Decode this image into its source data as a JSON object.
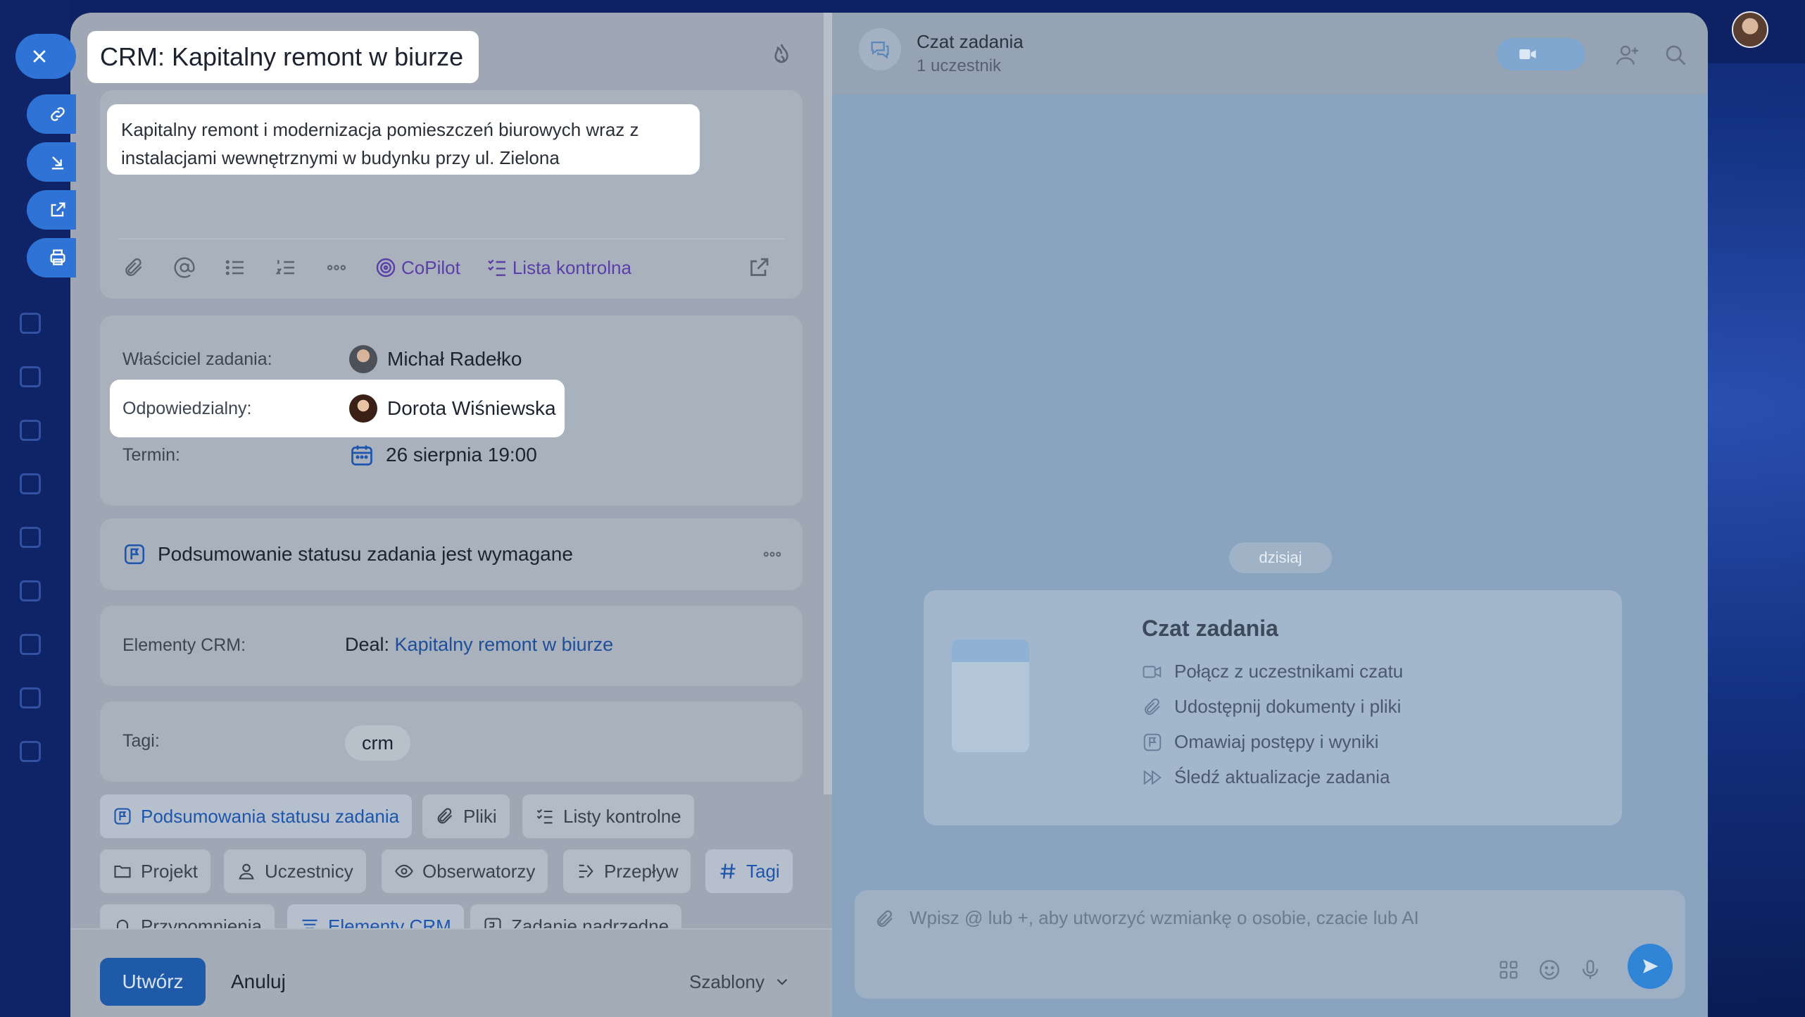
{
  "task": {
    "title": "CRM: Kapitalny remont w biurze",
    "description": "Kapitalny remont i modernizacja pomieszczeń biurowych wraz z instalacjami wewnętrznymi w budynku przy ul. Zielona",
    "toolbar": {
      "copilot_label": "CoPilot",
      "checklist_label": "Lista kontrolna"
    },
    "owner": {
      "label": "Właściciel zadania:",
      "name": "Michał Radełko"
    },
    "responsible": {
      "label": "Odpowiedzialny:",
      "name": "Dorota Wiśniewska"
    },
    "deadline": {
      "label": "Termin:",
      "value": "26 sierpnia 19:00"
    },
    "summary_required": "Podsumowanie statusu zadania jest wymagane",
    "crm": {
      "label": "Elementy CRM:",
      "prefix": "Deal:",
      "link": "Kapitalny remont w biurze"
    },
    "tags": {
      "label": "Tagi:",
      "items": [
        "crm"
      ]
    },
    "chips": [
      {
        "label": "Podsumowania statusu zadania",
        "icon": "flag-icon",
        "active": true
      },
      {
        "label": "Pliki",
        "icon": "paperclip-icon",
        "active": false
      },
      {
        "label": "Listy kontrolne",
        "icon": "checklist-icon",
        "active": false
      },
      {
        "label": "Projekt",
        "icon": "folder-icon",
        "active": false
      },
      {
        "label": "Uczestnicy",
        "icon": "user-icon",
        "active": false
      },
      {
        "label": "Obserwatorzy",
        "icon": "eye-icon",
        "active": false
      },
      {
        "label": "Przepływ",
        "icon": "flow-icon",
        "active": false
      },
      {
        "label": "Tagi",
        "icon": "hash-icon",
        "active": true
      },
      {
        "label": "Przypomnienia",
        "icon": "bell-icon",
        "active": false
      },
      {
        "label": "Elementy CRM",
        "icon": "crm-icon",
        "active": true
      },
      {
        "label": "Zadanie nadrzędne",
        "icon": "parent-task-icon",
        "active": false
      }
    ],
    "footer": {
      "create_label": "Utwórz",
      "cancel_label": "Anuluj",
      "templates_label": "Szablony"
    }
  },
  "chat": {
    "title": "Czat zadania",
    "participants": "1 uczestnik",
    "date_divider": "dzisiaj",
    "welcome": {
      "title": "Czat zadania",
      "items": [
        {
          "label": "Połącz z uczestnikami czatu",
          "icon": "video-icon"
        },
        {
          "label": "Udostępnij dokumenty i pliki",
          "icon": "paperclip-icon"
        },
        {
          "label": "Omawiaj postępy i wyniki",
          "icon": "flag-icon"
        },
        {
          "label": "Śledź aktualizacje zadania",
          "icon": "fast-forward-icon"
        }
      ]
    },
    "composer_placeholder": "Wpisz @ lub +, aby utworzyć wzmiankę o osobie, czacie lub AI"
  },
  "colors": {
    "accent": "#2f73d6",
    "create_button": "#1f5aa8",
    "link": "#1d4f9a",
    "copilot": "#5a3fa8"
  }
}
